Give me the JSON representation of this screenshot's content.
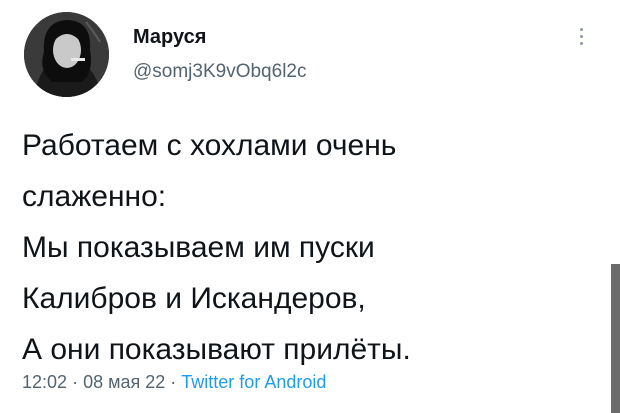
{
  "author": {
    "display_name": "Маруся",
    "handle": "@somj3K9vObq6l2c",
    "avatar_icon": "user-avatar-photo"
  },
  "tweet": {
    "lines": [
      "Работаем с хохлами очень",
      "слаженно:",
      "Мы показываем им пуски",
      "Калибров и Искандеров,",
      "А они показывают прилёты."
    ]
  },
  "meta": {
    "time": "12:02",
    "separator": "·",
    "date": "08 мая 22",
    "source": "Twitter for Android"
  },
  "colors": {
    "text": "#0f1419",
    "secondary": "#536471",
    "link": "#1d9bf0"
  }
}
